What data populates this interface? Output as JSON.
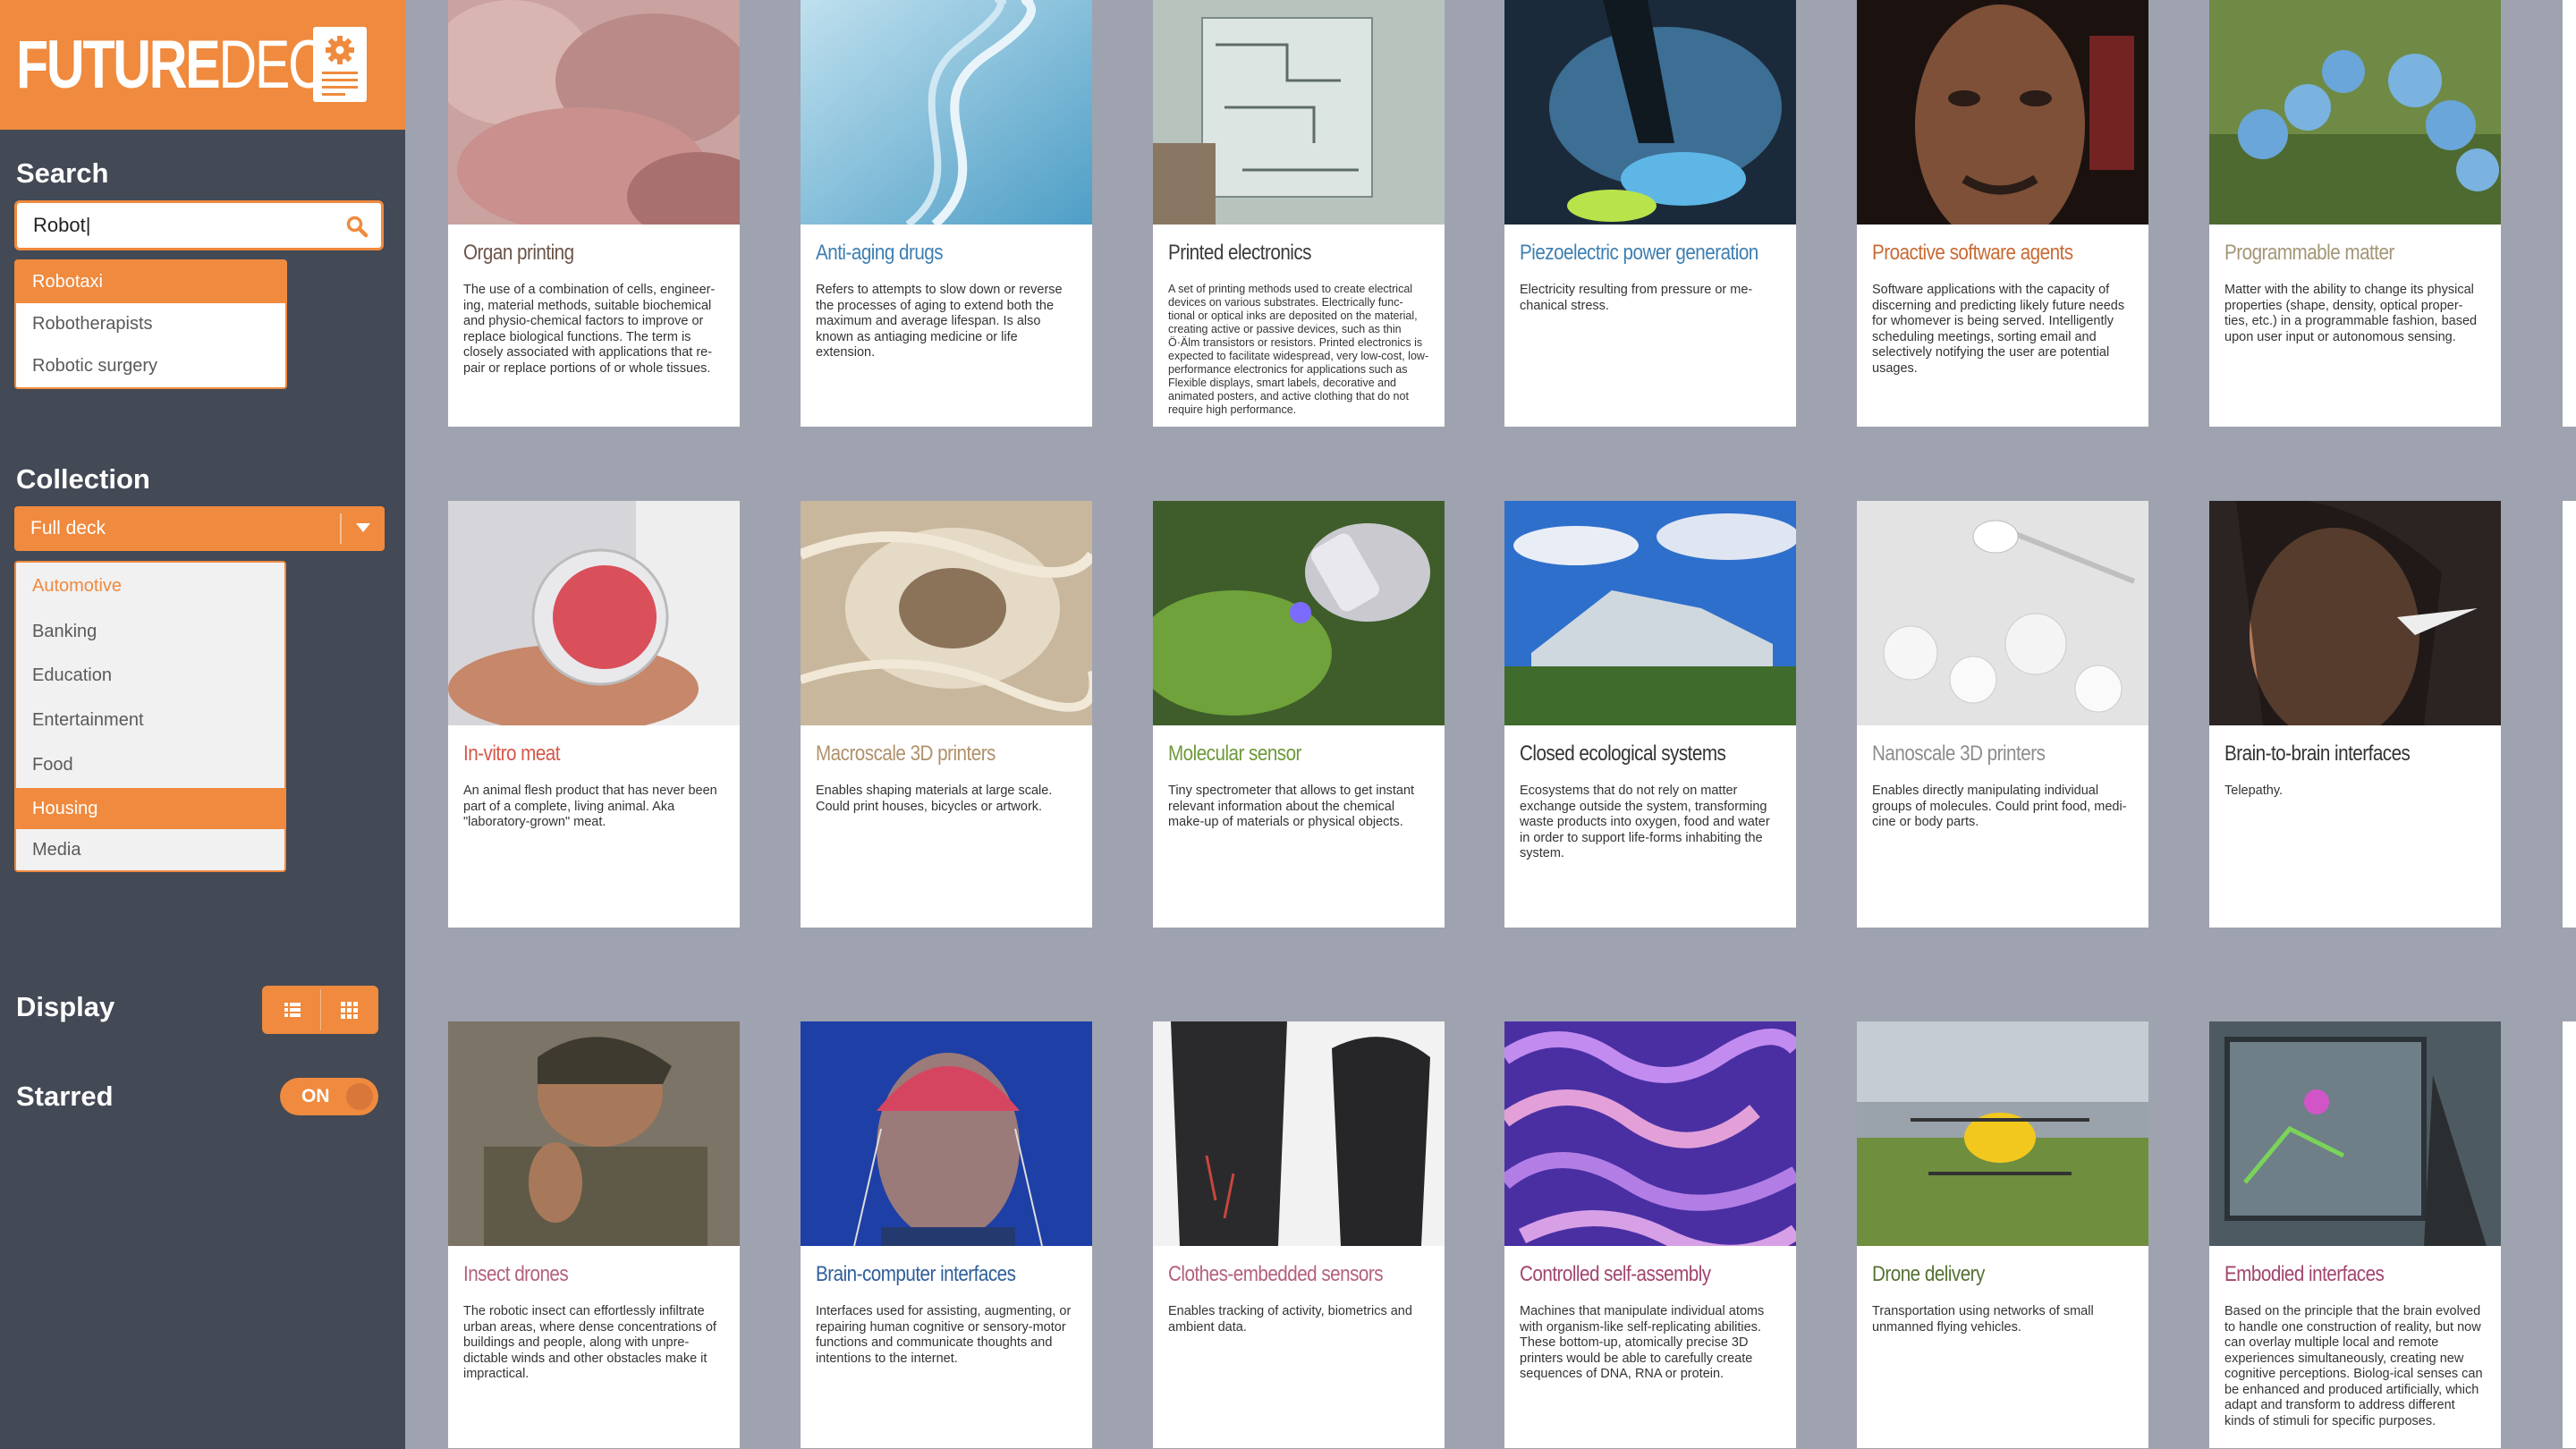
{
  "app": {
    "logo_bold": "FUTURE",
    "logo_light": "DECK",
    "colors": {
      "accent": "#ef8a3e",
      "sidebar": "#434955",
      "background": "#9ea3af"
    }
  },
  "sidebar": {
    "search": {
      "label": "Search",
      "value": "Robot|",
      "icon": "search-icon",
      "suggestions": [
        "Robotaxi",
        "Robotherapists",
        "Robotic surgery"
      ]
    },
    "collection": {
      "label": "Collection",
      "selected": "Full deck",
      "options": [
        "Automotive",
        "Banking",
        "Education",
        "Entertainment",
        "Food",
        "Housing",
        "Media"
      ]
    },
    "display": {
      "label": "Display",
      "icons": [
        "list-view-icon",
        "grid-view-icon"
      ]
    },
    "starred": {
      "label": "Starred",
      "toggle": "ON"
    }
  },
  "cards": [
    {
      "title": "Organ printing",
      "color": "#6b5549",
      "desc": "The use of a combination of cells, engineer-ing, material methods, suitable biochemical and physio-chemical factors to improve or replace biological functions. The term is closely associated with applications that re-pair or replace portions of or whole tissues."
    },
    {
      "title": "Anti-aging drugs",
      "color": "#3e7fb1",
      "desc": "Refers to attempts to slow down or reverse the processes of aging to extend both the maximum and average lifespan. Is also known as antiaging medicine or life extension."
    },
    {
      "title": "Printed electronics",
      "color": "#3a3a3a",
      "desc": "A set of printing methods used to create electrical devices on various substrates. Electrically func-tional or optical inks are deposited on the material, creating active or passive devices, such as thin Ö·Älm transistors or resistors. Printed electronics is expected to facilitate widespread, very low-cost, low-performance electronics for applications such as Flexible displays, smart labels, decorative and animated posters, and active clothing that do not require high performance."
    },
    {
      "title": "Piezoelectric power generation",
      "color": "#3e7fb1",
      "desc": "Electricity resulting from pressure or me-chanical stress."
    },
    {
      "title": "Proactive software agents",
      "color": "#c86a33",
      "desc": "Software applications with the capacity of discerning and predicting likely future needs for whomever is being served. Intelligently scheduling meetings, sorting email and selectively notifying the user are potential usages."
    },
    {
      "title": "Programmable matter",
      "color": "#a39576",
      "desc": "Matter with the ability to change its physical properties (shape, density, optical proper-ties, etc.) in a programmable fashion, based upon user input or autonomous sensing."
    },
    {
      "title": "In-vitro meat",
      "color": "#d4574a",
      "desc": "An animal flesh product that has never been part of a complete, living animal. Aka \"laboratory-grown\" meat."
    },
    {
      "title": "Macroscale 3D printers",
      "color": "#b0916b",
      "desc": "Enables shaping materials at large scale. Could print houses, bicycles or artwork."
    },
    {
      "title": "Molecular sensor",
      "color": "#6e9a3a",
      "desc": "Tiny spectrometer that allows to get instant relevant information about the chemical make-up of materials or physical objects."
    },
    {
      "title": "Closed ecological systems",
      "color": "#333333",
      "desc": "Ecosystems that do not rely on matter exchange outside the system, transforming waste products into oxygen, food and water in order to support life-forms inhabiting the system."
    },
    {
      "title": "Nanoscale 3D printers",
      "color": "#8d8d8d",
      "desc": "Enables directly manipulating individual groups of molecules. Could print food, medi-cine or body parts."
    },
    {
      "title": "Brain-to-brain interfaces",
      "color": "#333333",
      "desc": "Telepathy."
    },
    {
      "title": "Insect drones",
      "color": "#b4607d",
      "desc": "The robotic insect can effortlessly infiltrate urban areas, where dense concentrations of buildings and people, along with unpre-dictable winds and other obstacles make it impractical."
    },
    {
      "title": "Brain-computer interfaces",
      "color": "#2f5f9a",
      "desc": "Interfaces used for assisting, augmenting, or repairing human cognitive or sensory-motor functions and communicate thoughts and intentions to the internet."
    },
    {
      "title": "Clothes-embedded sensors",
      "color": "#b4607d",
      "desc": "Enables tracking of activity, biometrics and ambient data."
    },
    {
      "title": "Controlled self-assembly",
      "color": "#a2456e",
      "desc": "Machines that manipulate individual atoms with organism-like self-replicating abilities. These bottom-up, atomically precise 3D printers would be able to carefully create sequences of DNA, RNA or protein."
    },
    {
      "title": "Drone delivery",
      "color": "#557233",
      "desc": "Transportation using networks of small unmanned flying vehicles."
    },
    {
      "title": "Embodied interfaces",
      "color": "#a2456e",
      "desc": "Based on the principle that the brain evolved to handle one construction of reality, but now can overlay multiple local and remote experiences simultaneously, creating new cognitive perceptions. Biolog-ical senses can be enhanced and produced artificially, which adapt and transform to address different kinds of stimuli for specific purposes."
    }
  ]
}
